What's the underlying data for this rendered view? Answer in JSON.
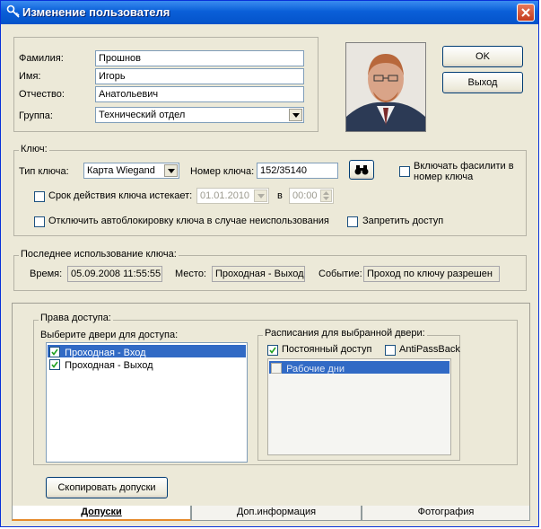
{
  "window": {
    "title": "Изменение пользователя"
  },
  "person": {
    "lastname_label": "Фамилия:",
    "lastname": "Прошнов",
    "firstname_label": "Имя:",
    "firstname": "Игорь",
    "patronymic_label": "Отчество:",
    "patronymic": "Анатольевич",
    "group_label": "Группа:",
    "group": "Технический отдел"
  },
  "buttons": {
    "ok": "OK",
    "exit": "Выход",
    "copy_permissions": "Скопировать допуски"
  },
  "key": {
    "legend": "Ключ:",
    "type_label": "Тип ключа:",
    "type": "Карта Wiegand",
    "number_label": "Номер ключа:",
    "number": "152/35140",
    "facility_label": "Включать фасилити в номер ключа",
    "expire_label": "Срок действия ключа истекает:",
    "expire_date": "01.01.2010",
    "expire_at_label": "в",
    "expire_time": "00:00",
    "disable_autoblock_label": "Отключить автоблокировку ключа в случае неиспользования",
    "deny_access_label": "Запретить доступ"
  },
  "last_use": {
    "legend": "Последнее использование ключа:",
    "time_label": "Время:",
    "time": "05.09.2008 11:55:55",
    "place_label": "Место:",
    "place": "Проходная - Выход",
    "event_label": "Событие:",
    "event": "Проход по ключу разрешен"
  },
  "access": {
    "legend": "Права доступа:",
    "doors_label": "Выберите двери для доступа:",
    "doors": [
      {
        "name": "Проходная - Вход",
        "checked": true,
        "selected": true
      },
      {
        "name": "Проходная - Выход",
        "checked": true,
        "selected": false
      }
    ],
    "schedule_label": "Расписания для выбранной двери:",
    "permanent_label": "Постоянный доступ",
    "antipassback_label": "AntiPassBack",
    "schedules": [
      {
        "name": "Рабочие дни",
        "checked": false
      }
    ]
  },
  "tabs": [
    "Допуски",
    "Доп.информация",
    "Фотография"
  ],
  "colors": {
    "title_bar": "#0a5fd8",
    "selection": "#316ac5",
    "tab_accent": "#e68b2c"
  }
}
